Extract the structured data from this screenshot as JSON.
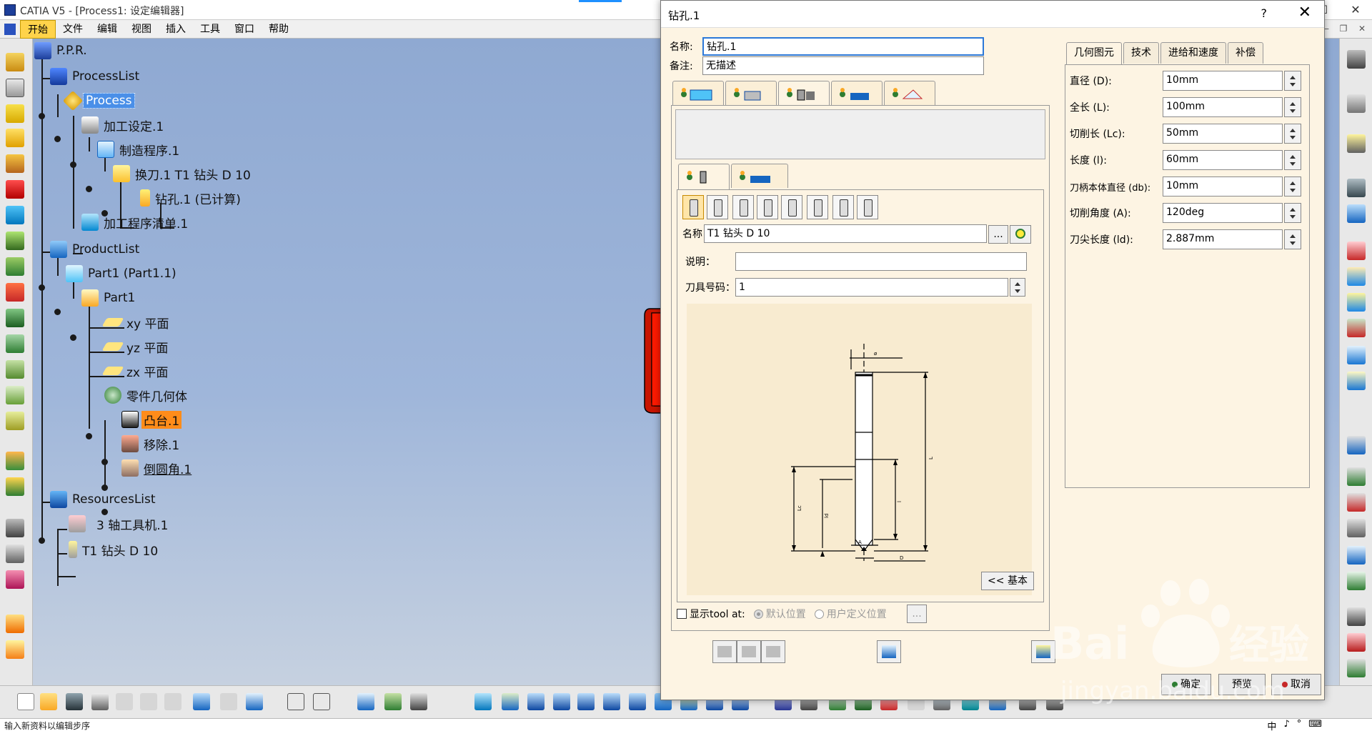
{
  "window": {
    "title": "CATIA V5 - [Process1: 设定编辑器]",
    "controls": [
      "—",
      "☐",
      "✕"
    ]
  },
  "menu": {
    "items": [
      "开始",
      "文件",
      "编辑",
      "视图",
      "插入",
      "工具",
      "窗口",
      "帮助"
    ],
    "active_index": 0
  },
  "tree": {
    "root": "P.P.R.",
    "process_list": "ProcessList",
    "process": "Process",
    "machining_setup": "加工设定.1",
    "manufacturing_program": "制造程序.1",
    "tool_change": "换刀.1  T1 钻头 D 10",
    "drilling": "钻孔.1 (已计算)",
    "program_list": "加工程序清单.1",
    "product_list": "ProductList",
    "part_instance": "Part1 (Part1.1)",
    "part": "Part1",
    "xy_plane": "xy 平面",
    "yz_plane": "yz 平面",
    "zx_plane": "zx 平面",
    "part_body": "零件几何体",
    "pad": "凸台.1",
    "pocket": "移除.1",
    "fillet": "倒圆角.1",
    "resources_list": "ResourcesList",
    "machine": "3 轴工具机.1",
    "tool": "T1 钻头 D 10"
  },
  "dialog": {
    "title": "钻孔.1",
    "help": "?",
    "close": "✕",
    "name_label": "名称:",
    "name_value": "钻孔.1",
    "comment_label": "备注:",
    "comment_value": "无描述",
    "tool_name_label": "名称",
    "tool_name_value": "T1 钻头 D 10",
    "browse_button": "...",
    "description_label": "说明：",
    "description_value": "",
    "tool_number_label": "刀具号码：",
    "tool_number_value": "1",
    "basic_button": "<< 基本",
    "show_tool_label": "显示tool at:",
    "default_position": "默认位置",
    "user_position": "用户定义位置",
    "position_browse": "...",
    "param_tabs": [
      "几何图元",
      "技术",
      "进给和速度",
      "补偿"
    ],
    "params": [
      {
        "label": "直径 (D):",
        "value": "10mm"
      },
      {
        "label": "全长 (L):",
        "value": "100mm"
      },
      {
        "label": "切削长 (Lc):",
        "value": "50mm"
      },
      {
        "label": "长度 (l):",
        "value": "60mm"
      },
      {
        "label": "刀柄本体直径 (db):",
        "value": "10mm"
      },
      {
        "label": "切削角度 (A):",
        "value": "120deg"
      },
      {
        "label": "刀尖长度 (ld):",
        "value": "2.887mm"
      }
    ],
    "ok_button": "确定",
    "preview_button": "预览",
    "cancel_button": "取消"
  },
  "status": {
    "text": "输入新资料以编辑步序",
    "ime": [
      "中",
      "♪",
      "°",
      "⌨"
    ]
  },
  "watermark": {
    "brand": "Bai",
    "cn": "经验",
    "url": "jingyan.baidu.com"
  },
  "colors": {
    "viewport_top": "#8fa9d2",
    "viewport_bottom": "#c6d1e0",
    "dialog_bg": "#fdf4e3",
    "selection_blue": "#4a8fe8",
    "selection_orange": "#ff8c1a",
    "part_red": "#ff1a00"
  }
}
